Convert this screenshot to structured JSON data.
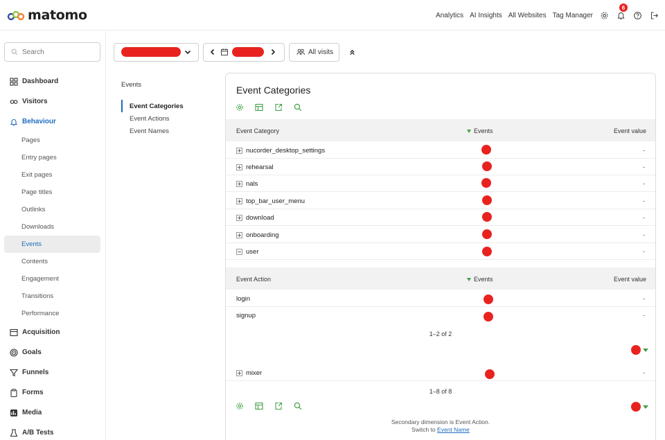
{
  "brand": {
    "name": "matomo"
  },
  "topnav": {
    "links": [
      "Analytics",
      "AI Insights",
      "All Websites",
      "Tag Manager"
    ],
    "notification_count": "6"
  },
  "sidebar": {
    "search_placeholder": "Search",
    "items": [
      {
        "label": "Dashboard",
        "icon": "dashboard-icon"
      },
      {
        "label": "Visitors",
        "icon": "visitors-icon"
      },
      {
        "label": "Behaviour",
        "icon": "bell-icon"
      }
    ],
    "behaviour_subitems": [
      "Pages",
      "Entry pages",
      "Exit pages",
      "Page titles",
      "Outlinks",
      "Downloads",
      "Events",
      "Contents",
      "Engagement",
      "Transitions",
      "Performance"
    ],
    "bottom_items": [
      {
        "label": "Acquisition",
        "icon": "acquisition-icon"
      },
      {
        "label": "Goals",
        "icon": "goals-icon"
      },
      {
        "label": "Funnels",
        "icon": "funnel-icon"
      },
      {
        "label": "Forms",
        "icon": "forms-icon"
      },
      {
        "label": "Media",
        "icon": "media-icon"
      },
      {
        "label": "A/B Tests",
        "icon": "flask-icon"
      }
    ]
  },
  "controls": {
    "segment_label": "All visits"
  },
  "report_nav": {
    "heading": "Events",
    "items": [
      "Event Categories",
      "Event Actions",
      "Event Names"
    ]
  },
  "card": {
    "title": "Event Categories",
    "columns": {
      "category": "Event Category",
      "events": "Events",
      "value": "Event value"
    },
    "rows": [
      {
        "name": "nucorder_desktop_settings",
        "value": "-"
      },
      {
        "name": "rehearsal",
        "value": "-"
      },
      {
        "name": "nals",
        "value": "-"
      },
      {
        "name": "top_bar_user_menu",
        "value": "-"
      },
      {
        "name": "download",
        "value": "-"
      },
      {
        "name": "onboarding",
        "value": "-"
      },
      {
        "name": "user",
        "value": "-"
      }
    ],
    "subtable": {
      "columns": {
        "action": "Event Action",
        "events": "Events",
        "value": "Event value"
      },
      "rows": [
        {
          "name": "login",
          "value": "-"
        },
        {
          "name": "signup",
          "value": "-"
        }
      ],
      "pagination": "1–2 of 2"
    },
    "extra_row": {
      "name": "mixer",
      "value": "-"
    },
    "pagination": "1–8 of 8",
    "footnote_line1": "Secondary dimension is Event Action.",
    "footnote_line2_prefix": "Switch to",
    "footnote_link": "Event Name"
  },
  "colors": {
    "accent": "#1f6dbf",
    "redaction": "#e8231f",
    "sort_indicator": "#43a047"
  }
}
